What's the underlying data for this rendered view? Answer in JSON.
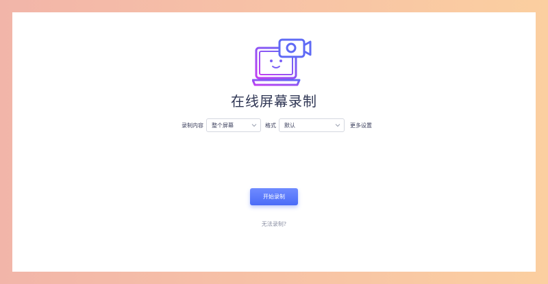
{
  "page": {
    "title": "在线屏幕录制",
    "logo_icon": "laptop-camera-icon"
  },
  "controls": {
    "content_label": "录制内容",
    "content_value": "整个屏幕",
    "format_label": "格式",
    "format_value": "默认",
    "more_settings": "更多设置"
  },
  "actions": {
    "start_label": "开始录制",
    "help_link": "无法录制?"
  },
  "colors": {
    "accent": "#4a6cf7",
    "icon_gradient_start": "#c13ef2",
    "icon_gradient_end": "#5f6af5",
    "title": "#2f3654"
  }
}
